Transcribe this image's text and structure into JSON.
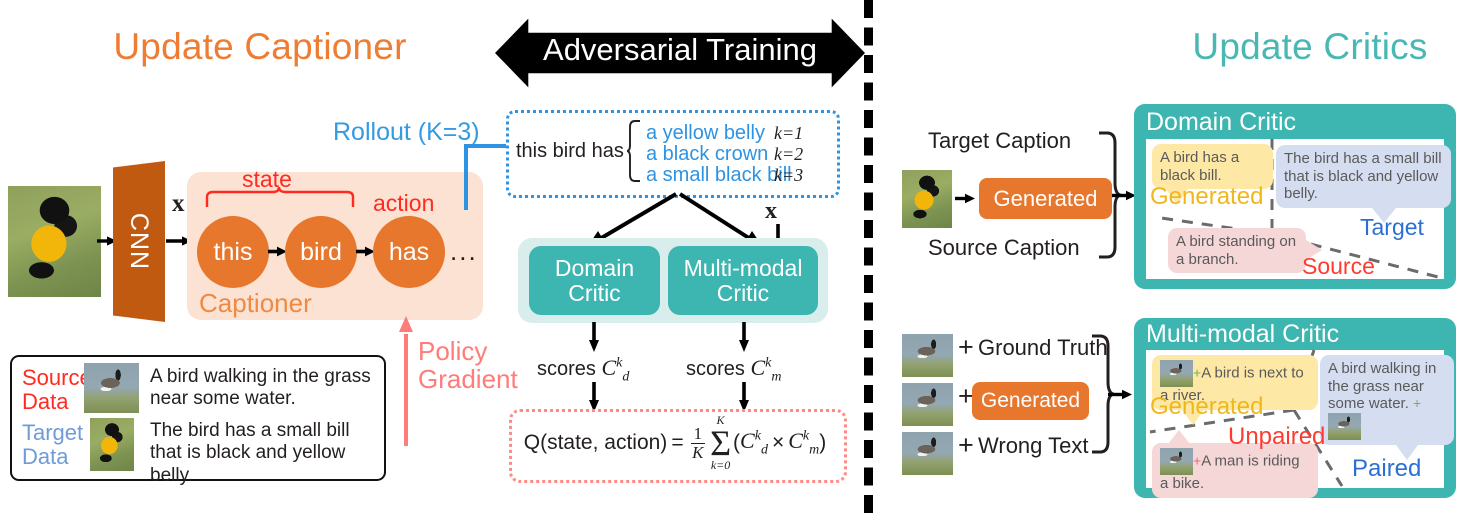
{
  "headers": {
    "left": "Update Captioner",
    "center": "Adversarial Training",
    "right": "Update Critics"
  },
  "colors": {
    "orange": "#E8772E",
    "orange_header": "#EE7D33",
    "teal": "#3DB5B0",
    "teal_header": "#49B8B3",
    "blue": "#2E93E0",
    "red": "#FF2A20",
    "pink": "#FF7C78",
    "cnn_brown": "#C05A10",
    "captioner_bg": "#FBE2D2",
    "critics_band_bg": "#D9EEEC",
    "bubble_yellow": "#FDE8A6",
    "bubble_blue": "#D5DEF0",
    "bubble_pink": "#F6D7D8",
    "label_yellow": "#F0B71C",
    "label_blue": "#2C6FD4",
    "label_red": "#FF3B30"
  },
  "captioner": {
    "cnn_label": "CNN",
    "x_label": "x",
    "state_label": "state",
    "action_label": "action",
    "box_label": "Captioner",
    "nodes": [
      "this",
      "bird",
      "has"
    ],
    "ellipsis": "...",
    "policy_gradient_line1": "Policy",
    "policy_gradient_line2": "Gradient"
  },
  "rollout": {
    "label": "Rollout (K=3)",
    "prefix": "this bird has",
    "candidates": [
      {
        "text": "a yellow belly",
        "k": "k=1"
      },
      {
        "text": "a black crown",
        "k": "k=2"
      },
      {
        "text": "a small black bill",
        "k": "k=3"
      }
    ]
  },
  "critics": {
    "domain_line1": "Domain",
    "domain_line2": "Critic",
    "mm_line1": "Multi-modal",
    "mm_line2": "Critic",
    "x_label": "x",
    "scores_word": "scores",
    "score_domain": "C",
    "score_domain_sub": "d",
    "score_domain_sup": "k",
    "score_mm": "C",
    "score_mm_sub": "m",
    "score_mm_sup": "k"
  },
  "equation": {
    "lhs": "Q(state, action)",
    "equals": "=",
    "frac_num": "1",
    "frac_den": "K",
    "sigma_top": "K",
    "sigma_bottom": "k=0",
    "rhs_open": "(",
    "times": "×",
    "rhs_close": ")",
    "term1": "C",
    "term1_sub": "d",
    "term1_sup": "k",
    "term2": "C",
    "term2_sub": "m",
    "term2_sup": "k"
  },
  "data_box": {
    "source_label_line1": "Source",
    "source_label_line2": "Data",
    "source_caption": "A bird walking in the grass near some water.",
    "target_label_line1": "Target",
    "target_label_line2": "Data",
    "target_caption": "The bird has a small bill that is black and yellow belly."
  },
  "domain_critic": {
    "target_caption_label": "Target Caption",
    "source_caption_label": "Source Caption",
    "generated_button": "Generated",
    "panel_title": "Domain Critic",
    "bubble_generated": "A bird has a black bill.",
    "bubble_target": "The bird has a small bill that is black and yellow belly.",
    "bubble_source": "A bird standing on a branch.",
    "label_generated": "Generated",
    "label_target": "Target",
    "label_source": "Source"
  },
  "multimodal_critic": {
    "row1_plus": "+",
    "row1_text": "Ground Truth",
    "row2_plus": "+",
    "row2_button": "Generated",
    "row3_plus": "+",
    "row3_text": "Wrong Text",
    "panel_title": "Multi-modal Critic",
    "bubble_generated": "A bird is next to a river.",
    "bubble_paired": "A bird walking in the grass near some water.",
    "bubble_unpaired": "A man is riding a bike.",
    "label_generated": "Generated",
    "label_unpaired": "Unpaired",
    "label_paired": "Paired",
    "inline_plus": "+"
  },
  "icons": {
    "bird_yellow": "yellow-black-oriole-photo",
    "bird_goose": "goose-in-grass-photo",
    "arrow": "arrow-right-icon",
    "brace": "curly-brace-icon",
    "divider": "vertical-dashed-divider"
  }
}
